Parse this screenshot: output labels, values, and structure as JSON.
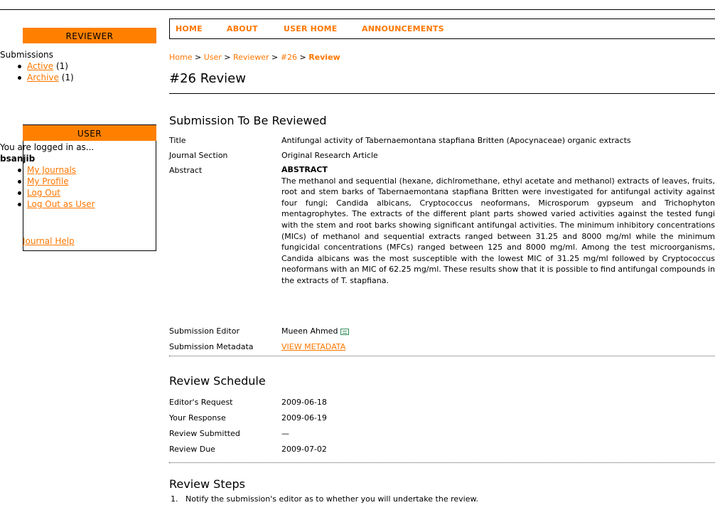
{
  "nav": [
    "HOME",
    "ABOUT",
    "USER HOME",
    "ANNOUNCEMENTS"
  ],
  "reviewer": {
    "title": "REVIEWER",
    "submissions_label": "Submissions",
    "items": [
      {
        "link": "Active",
        "count": "(1)"
      },
      {
        "link": "Archive",
        "count": "(1)"
      }
    ]
  },
  "user": {
    "title": "USER",
    "logged_in_text": "You are logged in as...",
    "username": "bsanjib",
    "links": [
      "My Journals",
      "My Profile",
      "Log Out",
      "Log Out as User"
    ]
  },
  "journal_help": "Journal Help",
  "breadcrumb": [
    "Home",
    "User",
    "Reviewer",
    "#26",
    "Review"
  ],
  "page_title": "#26 Review",
  "submission": {
    "heading": "Submission To Be Reviewed",
    "title_label": "Title",
    "title_value": "Antifungal activity of Tabernaemontana stapfiana Britten (Apocynaceae) organic extracts",
    "section_label": "Journal Section",
    "section_value": "Original Research Article",
    "abstract_label": "Abstract",
    "abstract_heading": "ABSTRACT",
    "abstract_text": "The methanol and sequential (hexane, dichlromethane, ethyl acetate and methanol) extracts of leaves, fruits, root and stem barks of Tabernaemontana stapfiana Britten were investigated for antifungal activity against four fungi; Candida albicans, Cryptococcus neoformans, Microsporum gypseum and Trichophyton mentagrophytes. The extracts of the different plant parts showed varied activities against the tested fungi with the stem and root barks showing significant antifungal activities. The minimum inhibitory concentrations (MICs) of methanol and sequential extracts ranged between 31.25 and 8000 mg/ml while the minimum fungicidal concentrations (MFCs) ranged between 125 and 8000 mg/ml. Among the test microorganisms, Candida albicans was the most susceptible with the lowest MIC of 31.25 mg/ml followed by Cryptococcus neoformans with an MIC of 62.25 mg/ml. These results show that it is possible to find antifungal compounds in the extracts of T. stapfiana.",
    "editor_label": "Submission Editor",
    "editor_value": "Mueen Ahmed",
    "metadata_label": "Submission Metadata",
    "metadata_link": "VIEW METADATA"
  },
  "schedule": {
    "heading": "Review Schedule",
    "rows": [
      {
        "label": "Editor's Request",
        "value": "2009-06-18"
      },
      {
        "label": "Your Response",
        "value": "2009-06-19"
      },
      {
        "label": "Review Submitted",
        "value": "—"
      },
      {
        "label": "Review Due",
        "value": "2009-07-02"
      }
    ]
  },
  "steps": {
    "heading": "Review Steps",
    "items": [
      "1.   Notify the submission's editor as to whether you will undertake the review."
    ]
  },
  "colors": {
    "accent": "#ff8000",
    "link": "#ff7700"
  },
  "icons": {
    "editor_email": "email-icon"
  }
}
